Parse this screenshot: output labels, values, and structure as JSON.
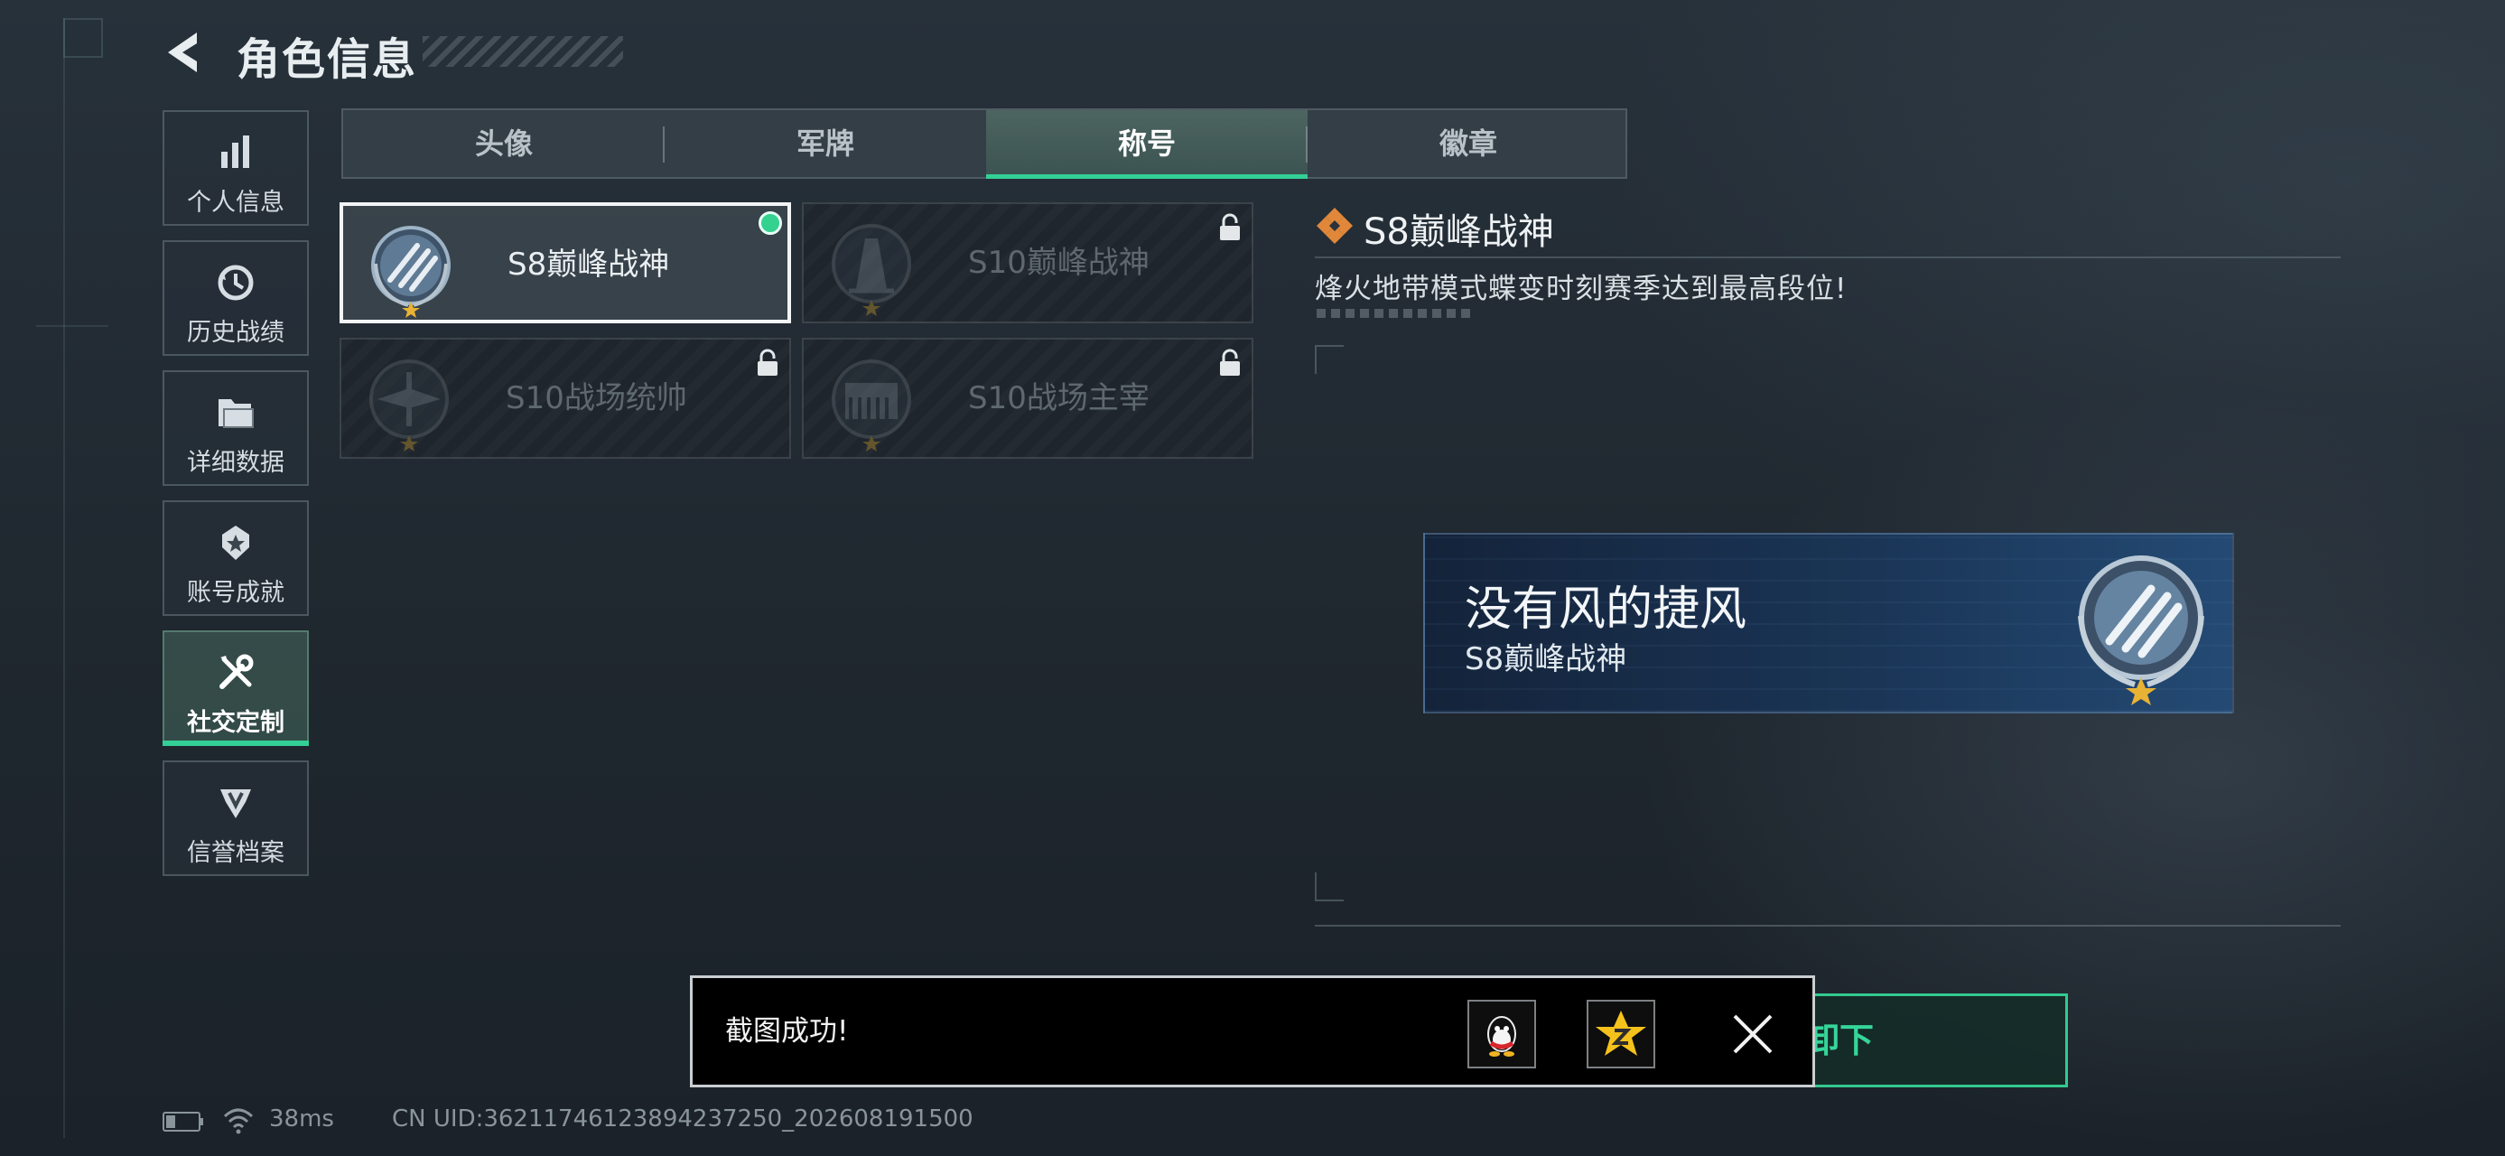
{
  "header": {
    "title": "角色信息"
  },
  "sidebar": {
    "items": [
      {
        "label": "个人信息",
        "icon": "bar-chart-icon",
        "active": false
      },
      {
        "label": "历史战绩",
        "icon": "clock-history-icon",
        "active": false
      },
      {
        "label": "详细数据",
        "icon": "folder-icon",
        "active": false
      },
      {
        "label": "账号成就",
        "icon": "achievement-badge-icon",
        "active": false
      },
      {
        "label": "社交定制",
        "icon": "wrench-screwdriver-icon",
        "active": true
      },
      {
        "label": "信誉档案",
        "icon": "shield-wing-icon",
        "active": false
      }
    ]
  },
  "tabs": [
    {
      "label": "头像",
      "active": false
    },
    {
      "label": "军牌",
      "active": false
    },
    {
      "label": "称号",
      "active": true
    },
    {
      "label": "徽章",
      "active": false
    }
  ],
  "titles": [
    {
      "name": "S8巅峰战神",
      "selected": true,
      "locked": false,
      "equipped": true
    },
    {
      "name": "S10巅峰战神",
      "selected": false,
      "locked": true,
      "equipped": false
    },
    {
      "name": "S10战场统帅",
      "selected": false,
      "locked": true,
      "equipped": false
    },
    {
      "name": "S10战场主宰",
      "selected": false,
      "locked": true,
      "equipped": false
    }
  ],
  "detail": {
    "title": "S8巅峰战神",
    "description": "烽火地带模式蝶变时刻赛季达到最高段位!"
  },
  "preview": {
    "player_name": "没有风的捷风",
    "title": "S8巅峰战神"
  },
  "action_button": {
    "label_visible": "卸下"
  },
  "toast": {
    "message": "截图成功!",
    "share_targets": [
      "qq-share-icon",
      "qzone-share-icon"
    ]
  },
  "status": {
    "ping": "38ms",
    "uid": "CN UID:36211746123894237250_202608191500"
  },
  "colors": {
    "accent_green": "#33d096",
    "medal_star": "#e8b234",
    "detail_icon": "#e0873a"
  }
}
